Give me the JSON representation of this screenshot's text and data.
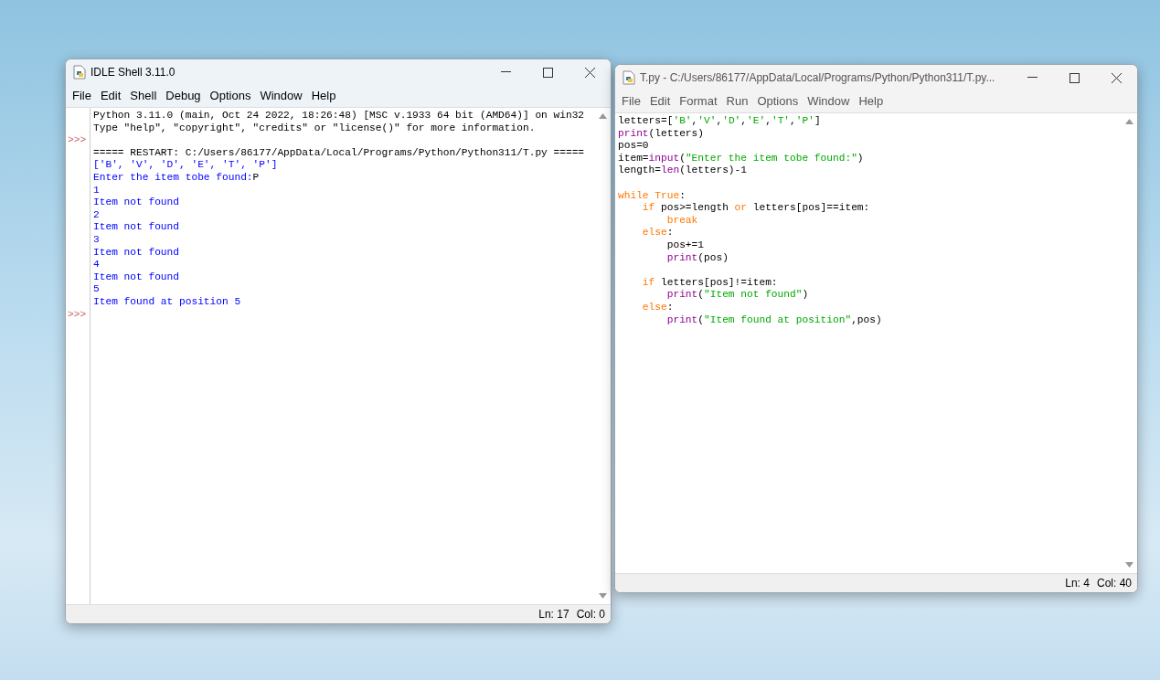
{
  "windows": [
    {
      "title": "IDLE Shell 3.11.0",
      "kind": "shell",
      "menu": [
        "File",
        "Edit",
        "Shell",
        "Debug",
        "Options",
        "Window",
        "Help"
      ],
      "lines": [
        {
          "tokens": [
            {
              "text": "Python 3.11.0 (main, Oct 24 2022, 18:26:48) [MSC v.1933 64 bit (AMD64)] on win32",
              "kind": "plain"
            }
          ]
        },
        {
          "tokens": [
            {
              "text": "Type \"help\", \"copyright\", \"credits\" or \"license()\" for more information.",
              "kind": "plain"
            }
          ]
        },
        {
          "prompt": ">>>"
        },
        {
          "tokens": [
            {
              "text": "===== RESTART: C:/Users/86177/AppData/Local/Programs/Python/Python311/T.py =====",
              "kind": "plain"
            }
          ]
        },
        {
          "tokens": [
            {
              "text": "['B', 'V', 'D', 'E', 'T', 'P']",
              "kind": "stdout"
            }
          ]
        },
        {
          "tokens": [
            {
              "text": "Enter the item tobe found:",
              "kind": "stdout"
            },
            {
              "text": "P",
              "kind": "plain"
            }
          ]
        },
        {
          "tokens": [
            {
              "text": "1",
              "kind": "stdout"
            }
          ]
        },
        {
          "tokens": [
            {
              "text": "Item not found",
              "kind": "stdout"
            }
          ]
        },
        {
          "tokens": [
            {
              "text": "2",
              "kind": "stdout"
            }
          ]
        },
        {
          "tokens": [
            {
              "text": "Item not found",
              "kind": "stdout"
            }
          ]
        },
        {
          "tokens": [
            {
              "text": "3",
              "kind": "stdout"
            }
          ]
        },
        {
          "tokens": [
            {
              "text": "Item not found",
              "kind": "stdout"
            }
          ]
        },
        {
          "tokens": [
            {
              "text": "4",
              "kind": "stdout"
            }
          ]
        },
        {
          "tokens": [
            {
              "text": "Item not found",
              "kind": "stdout"
            }
          ]
        },
        {
          "tokens": [
            {
              "text": "5",
              "kind": "stdout"
            }
          ]
        },
        {
          "tokens": [
            {
              "text": "Item found at position 5",
              "kind": "stdout"
            }
          ]
        },
        {
          "prompt": ">>>"
        }
      ],
      "status": {
        "line": "Ln: 17",
        "col": "Col: 0"
      }
    },
    {
      "title": "T.py - C:/Users/86177/AppData/Local/Programs/Python/Python311/T.py...",
      "kind": "editor",
      "menu": [
        "File",
        "Edit",
        "Format",
        "Run",
        "Options",
        "Window",
        "Help"
      ],
      "lines": [
        {
          "tokens": [
            {
              "text": "letters=[",
              "kind": "plain"
            },
            {
              "text": "'B'",
              "kind": "string"
            },
            {
              "text": ",",
              "kind": "plain"
            },
            {
              "text": "'V'",
              "kind": "string"
            },
            {
              "text": ",",
              "kind": "plain"
            },
            {
              "text": "'D'",
              "kind": "string"
            },
            {
              "text": ",",
              "kind": "plain"
            },
            {
              "text": "'E'",
              "kind": "string"
            },
            {
              "text": ",",
              "kind": "plain"
            },
            {
              "text": "'T'",
              "kind": "string"
            },
            {
              "text": ",",
              "kind": "plain"
            },
            {
              "text": "'P'",
              "kind": "string"
            },
            {
              "text": "]",
              "kind": "plain"
            }
          ]
        },
        {
          "tokens": [
            {
              "text": "print",
              "kind": "builtin"
            },
            {
              "text": "(letters)",
              "kind": "plain"
            }
          ]
        },
        {
          "tokens": [
            {
              "text": "pos=0",
              "kind": "plain"
            }
          ]
        },
        {
          "tokens": [
            {
              "text": "item=",
              "kind": "plain"
            },
            {
              "text": "input",
              "kind": "builtin"
            },
            {
              "text": "(",
              "kind": "plain"
            },
            {
              "text": "\"Enter the item tobe found:\"",
              "kind": "string"
            },
            {
              "text": ")",
              "kind": "plain"
            }
          ]
        },
        {
          "tokens": [
            {
              "text": "length=",
              "kind": "plain"
            },
            {
              "text": "len",
              "kind": "builtin"
            },
            {
              "text": "(letters)-1",
              "kind": "plain"
            }
          ]
        },
        {
          "gap_before": true,
          "tokens": [
            {
              "text": "while True",
              "kind": "keyword"
            },
            {
              "text": ":",
              "kind": "plain"
            }
          ]
        },
        {
          "tokens": [
            {
              "text": "    if",
              "kind": "keyword"
            },
            {
              "text": " pos>=length ",
              "kind": "plain"
            },
            {
              "text": "or",
              "kind": "keyword"
            },
            {
              "text": " letters[pos]==item:",
              "kind": "plain"
            }
          ]
        },
        {
          "tokens": [
            {
              "text": "        break",
              "kind": "keyword"
            }
          ]
        },
        {
          "tokens": [
            {
              "text": "    else",
              "kind": "keyword"
            },
            {
              "text": ":",
              "kind": "plain"
            }
          ]
        },
        {
          "tokens": [
            {
              "text": "        pos+=1",
              "kind": "plain"
            }
          ]
        },
        {
          "tokens": [
            {
              "text": "        print",
              "kind": "builtin"
            },
            {
              "text": "(pos)",
              "kind": "plain"
            }
          ]
        },
        {
          "gap_before": true,
          "tokens": [
            {
              "text": "    if",
              "kind": "keyword"
            },
            {
              "text": " letters[pos]!=item:",
              "kind": "plain"
            }
          ]
        },
        {
          "tokens": [
            {
              "text": "        print",
              "kind": "builtin"
            },
            {
              "text": "(",
              "kind": "plain"
            },
            {
              "text": "\"Item not found\"",
              "kind": "string"
            },
            {
              "text": ")",
              "kind": "plain"
            }
          ]
        },
        {
          "tokens": [
            {
              "text": "    else",
              "kind": "keyword"
            },
            {
              "text": ":",
              "kind": "plain"
            }
          ]
        },
        {
          "tokens": [
            {
              "text": "        print",
              "kind": "builtin"
            },
            {
              "text": "(",
              "kind": "plain"
            },
            {
              "text": "\"Item found at position\"",
              "kind": "string"
            },
            {
              "text": ",pos)",
              "kind": "plain"
            }
          ]
        }
      ],
      "status": {
        "line": "Ln: 4",
        "col": "Col: 40"
      }
    }
  ]
}
